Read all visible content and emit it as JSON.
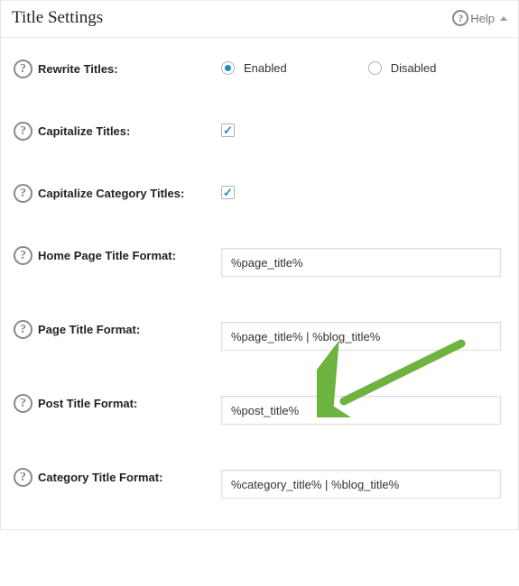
{
  "header": {
    "title": "Title Settings",
    "help_label": "Help"
  },
  "rows": {
    "rewrite_titles": {
      "label": "Rewrite Titles:",
      "enabled_label": "Enabled",
      "disabled_label": "Disabled",
      "selected": "enabled"
    },
    "capitalize_titles": {
      "label": "Capitalize Titles:",
      "checked": true
    },
    "capitalize_category_titles": {
      "label": "Capitalize Category Titles:",
      "checked": true
    },
    "home_page_title_format": {
      "label": "Home Page Title Format:",
      "value": "%page_title%"
    },
    "page_title_format": {
      "label": "Page Title Format:",
      "value": "%page_title% | %blog_title%"
    },
    "post_title_format": {
      "label": "Post Title Format:",
      "value": "%post_title%"
    },
    "category_title_format": {
      "label": "Category Title Format:",
      "value": "%category_title% | %blog_title%"
    }
  }
}
